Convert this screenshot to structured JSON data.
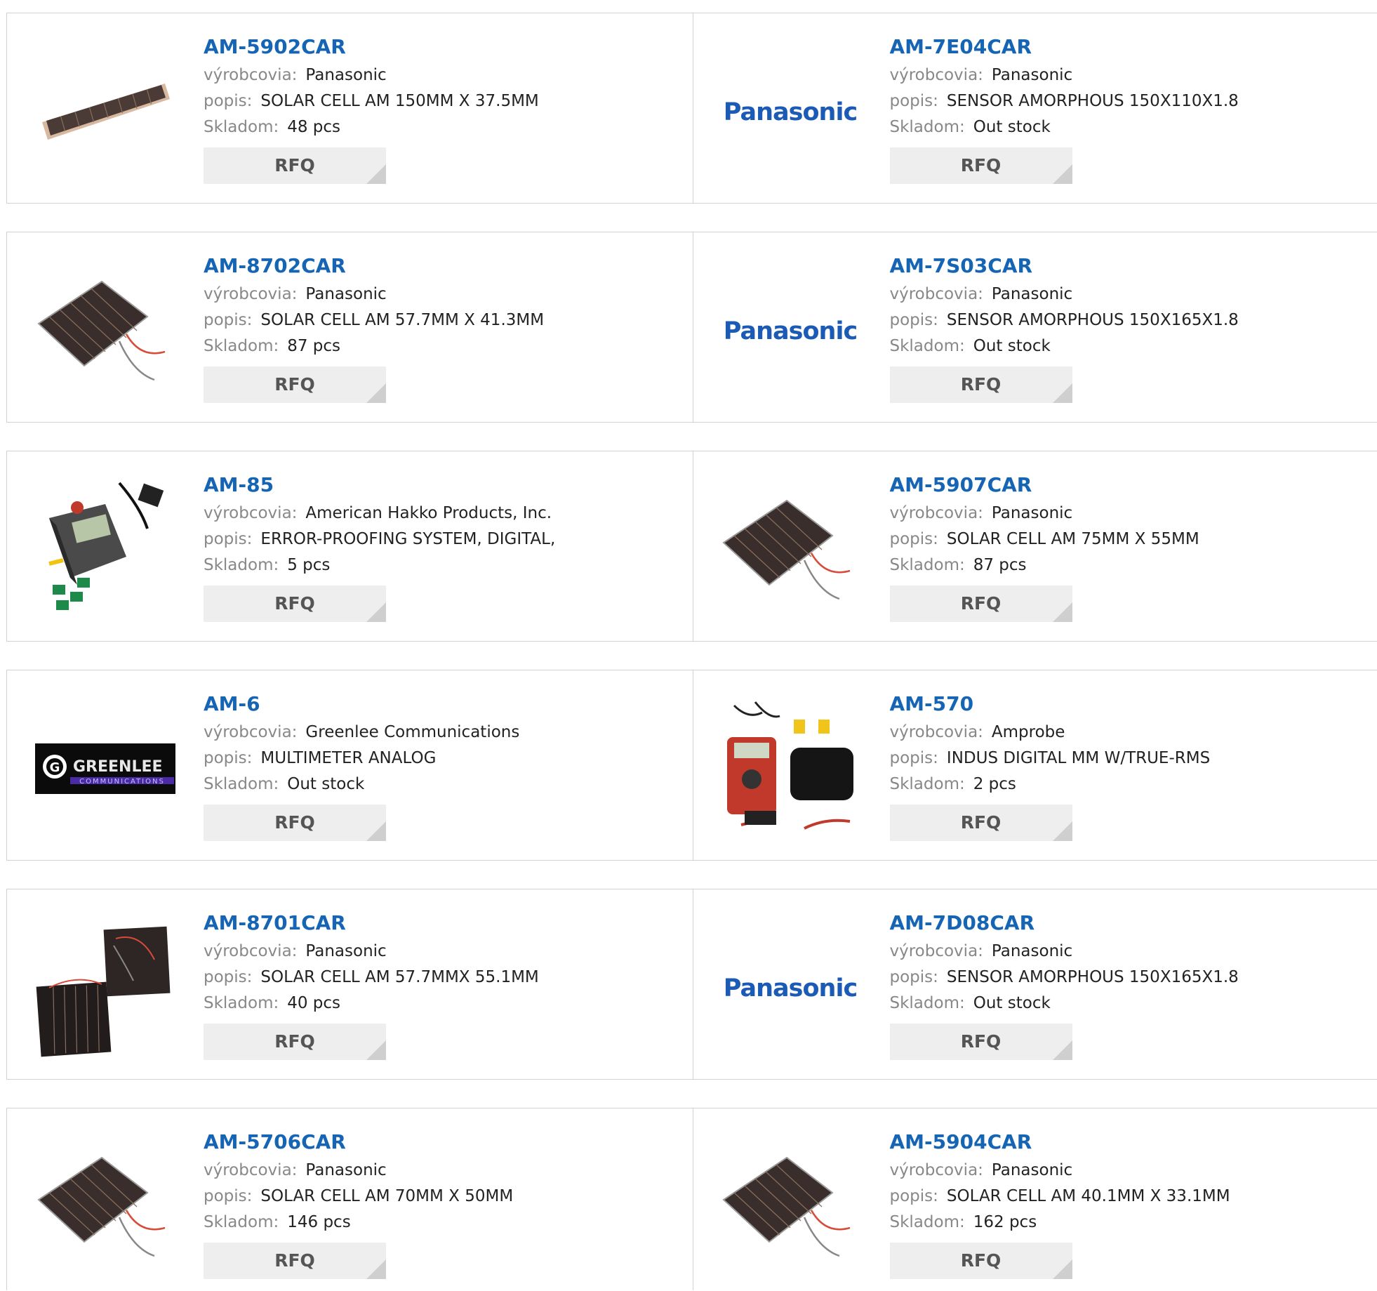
{
  "labels": {
    "manufacturer": "výrobcovia:",
    "description": "popis:",
    "stock": "Skladom:",
    "rfq": "RFQ"
  },
  "products": [
    {
      "pn": "AM-5902CAR",
      "manufacturer": "Panasonic",
      "description": "SOLAR CELL AM 150MM X 37.5MM",
      "stock": "48 pcs",
      "image": "solar-strip"
    },
    {
      "pn": "AM-7E04CAR",
      "manufacturer": "Panasonic",
      "description": "SENSOR AMORPHOUS 150X110X1.8",
      "stock": "Out stock",
      "image": "panasonic-logo"
    },
    {
      "pn": "AM-8702CAR",
      "manufacturer": "Panasonic",
      "description": "SOLAR CELL AM 57.7MM X 41.3MM",
      "stock": "87 pcs",
      "image": "solar-cell-wired"
    },
    {
      "pn": "AM-7S03CAR",
      "manufacturer": "Panasonic",
      "description": "SENSOR AMORPHOUS 150X165X1.8",
      "stock": "Out stock",
      "image": "panasonic-logo"
    },
    {
      "pn": "AM-85",
      "manufacturer": "American Hakko Products, Inc.",
      "description": "ERROR-PROOFING SYSTEM, DIGITAL,",
      "stock": "5 pcs",
      "image": "hakko-device"
    },
    {
      "pn": "AM-5907CAR",
      "manufacturer": "Panasonic",
      "description": "SOLAR CELL AM 75MM X 55MM",
      "stock": "87 pcs",
      "image": "solar-cell-wired"
    },
    {
      "pn": "AM-6",
      "manufacturer": "Greenlee Communications",
      "description": "MULTIMETER ANALOG",
      "stock": "Out stock",
      "image": "greenlee-logo"
    },
    {
      "pn": "AM-570",
      "manufacturer": "Amprobe",
      "description": "INDUS DIGITAL MM W/TRUE-RMS",
      "stock": "2 pcs",
      "image": "multimeter-kit"
    },
    {
      "pn": "AM-8701CAR",
      "manufacturer": "Panasonic",
      "description": "SOLAR CELL AM 57.7MMX 55.1MM",
      "stock": "40 pcs",
      "image": "solar-cell-pair"
    },
    {
      "pn": "AM-7D08CAR",
      "manufacturer": "Panasonic",
      "description": "SENSOR AMORPHOUS 150X165X1.8",
      "stock": "Out stock",
      "image": "panasonic-logo"
    },
    {
      "pn": "AM-5706CAR",
      "manufacturer": "Panasonic",
      "description": "SOLAR CELL AM 70MM X 50MM",
      "stock": "146 pcs",
      "image": "solar-cell-wired"
    },
    {
      "pn": "AM-5904CAR",
      "manufacturer": "Panasonic",
      "description": "SOLAR CELL AM 40.1MM X 33.1MM",
      "stock": "162 pcs",
      "image": "solar-cell-wired"
    }
  ],
  "logos": {
    "panasonic": "Panasonic",
    "greenlee": "GREENLEE",
    "greenlee_sub": "COMMUNICATIONS"
  },
  "colors": {
    "part_link": "#1565b4",
    "panasonic_blue": "#1b5bb5",
    "rfq_bg": "#eeeeee",
    "border": "#d2d2d2"
  }
}
